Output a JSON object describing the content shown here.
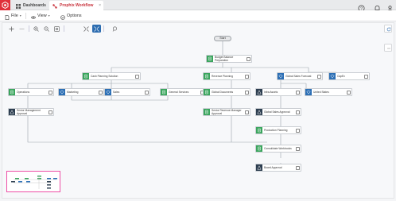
{
  "app": {
    "tabs": [
      {
        "label": "Dashboards",
        "icon": "grid-icon"
      },
      {
        "label": "Prophix Workflow",
        "icon": "workflow-icon",
        "close": "×"
      }
    ],
    "right_icons": [
      "help-icon",
      "bell-icon",
      "user-avatar-icon"
    ]
  },
  "menu": {
    "file": "File",
    "view": "View",
    "options": "Options"
  },
  "colors": {
    "brand_red": "#e0303a",
    "accent_blue": "#2c6cb0",
    "task_green": "#3aa55d",
    "task_blue": "#2c6fb5",
    "approval_navy": "#2d3e50",
    "minimap_border": "#ee4fa7"
  },
  "workflow": {
    "start_label": "Start",
    "nodes": [
      {
        "id": "budget_prep",
        "label": [
          "Budget Balance",
          "Preparation"
        ],
        "icon": "green"
      },
      {
        "id": "cash_flow",
        "label": [
          "Cash Planning Solution"
        ],
        "icon": "green"
      },
      {
        "id": "revenue",
        "label": [
          "Revenue Planning"
        ],
        "icon": "green"
      },
      {
        "id": "global_sales",
        "label": [
          "Global Sales Forecast"
        ],
        "icon": "blue"
      },
      {
        "id": "capex",
        "label": [
          "CapEx"
        ],
        "icon": "blue"
      },
      {
        "id": "operations",
        "label": [
          "Operations"
        ],
        "icon": "green"
      },
      {
        "id": "marketing",
        "label": [
          "Marketing"
        ],
        "icon": "blue"
      },
      {
        "id": "sales",
        "label": [
          "Sales"
        ],
        "icon": "blue"
      },
      {
        "id": "general_services",
        "label": [
          "General Services"
        ],
        "icon": "green"
      },
      {
        "id": "global_documents",
        "label": [
          "Global Documents"
        ],
        "icon": "green"
      },
      {
        "id": "infra_assets",
        "label": [
          "Infra Assets"
        ],
        "icon": "navy"
      },
      {
        "id": "united_states",
        "label": [
          "United States"
        ],
        "icon": "blue"
      },
      {
        "id": "senior_mgmt",
        "label": [
          "Senior Management",
          "Approval"
        ],
        "icon": "navy"
      },
      {
        "id": "senior_revenue",
        "label": [
          "Senior Revenue Manager",
          "Approval"
        ],
        "icon": "green"
      },
      {
        "id": "global_sales_approval",
        "label": [
          "Global Sales Approval"
        ],
        "icon": "navy"
      },
      {
        "id": "production_planning",
        "label": [
          "Production Planning"
        ],
        "icon": "green"
      },
      {
        "id": "consolidate",
        "label": [
          "Consolidate Workbooks"
        ],
        "icon": "green"
      },
      {
        "id": "board_approval",
        "label": [
          "Board Approval"
        ],
        "icon": "navy"
      }
    ]
  }
}
